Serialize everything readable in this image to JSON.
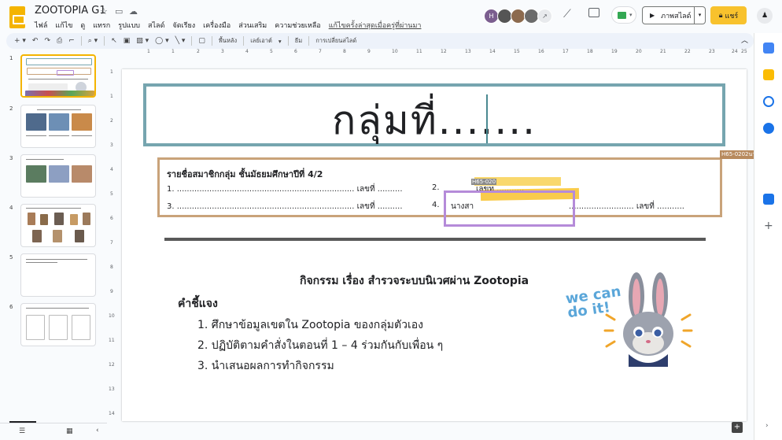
{
  "app": {
    "title": "ZOOTOPIA G1",
    "last_edit": "แก้ไขครั้งล่าสุดเมื่อครู่ที่ผ่านมา"
  },
  "menu": [
    "ไฟล์",
    "แก้ไข",
    "ดู",
    "แทรก",
    "รูปแบบ",
    "สไลด์",
    "จัดเรียง",
    "เครื่องมือ",
    "ส่วนเสริม",
    "ความช่วยเหลือ"
  ],
  "header": {
    "slideshow_label": "ภาพสไลด์",
    "share_label": "แชร์"
  },
  "toolbar": {
    "background": "พื้นหลัง",
    "layout": "เลย์เอาต์",
    "theme": "ธีม",
    "transition": "การเปลี่ยนสไลด์"
  },
  "filmstrip": {
    "numbers": [
      "1",
      "2",
      "3",
      "4",
      "5",
      "6"
    ]
  },
  "ruler": {
    "h": [
      "1",
      "1",
      "2",
      "3",
      "4",
      "5",
      "6",
      "7",
      "8",
      "9",
      "10",
      "11",
      "12",
      "13",
      "14",
      "15",
      "16",
      "17",
      "18",
      "19",
      "20",
      "21",
      "22",
      "23",
      "24",
      "25"
    ],
    "v": [
      "1",
      "1",
      "2",
      "3",
      "4",
      "5",
      "6",
      "7",
      "8",
      "9",
      "10",
      "11",
      "12",
      "13",
      "14"
    ]
  },
  "slide": {
    "title": "กลุ่มที่.......",
    "member_heading": "รายชื่อสมาชิกกลุ่ม ชั้นมัธยมศึกษาปีที่ 4/2",
    "row1_left": "1. ....................................................................... เลขที่ ..........",
    "row1_right": "2.",
    "row1_right2": "เลขท ...........",
    "row2_left": "3. ....................................................................... เลขที่ ..........",
    "row2_right": "4.",
    "row2_right2": "นางสา",
    "row2_right3": ".......................... เลขที่ ...........",
    "tag_1": "H65-020",
    "tag_2": "H65-0202นาย",
    "activity_title": "กิจกรรม เรื่อง สำรวจระบบนิเวศผ่าน Zootopia",
    "instructions_label": "คำชี้แจง",
    "steps": [
      "1.  ศึกษาข้อมูลเขตใน Zootopia ของกลุ่มตัวเอง",
      "2.  ปฏิบัติตามคำสั่งในตอนที่ 1 – 4 ร่วมกันกับเพื่อน ๆ",
      "3.  นำเสนอผลการทำกิจกรรม"
    ],
    "sticker_text": "we can do it!"
  },
  "colors": {
    "title_border": "#76a5af",
    "member_border": "#c9a37a",
    "highlight": "#f8c22d",
    "selection": "#b58bd9",
    "share_btn": "#f8c22d"
  }
}
